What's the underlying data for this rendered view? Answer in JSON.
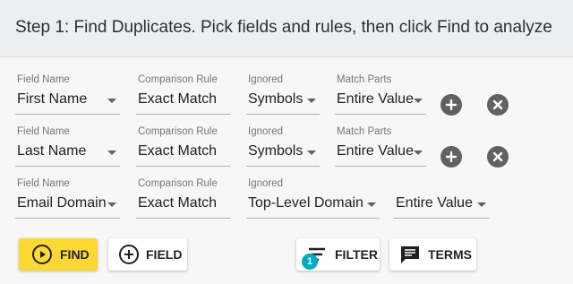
{
  "header": {
    "title": "Step 1: Find Duplicates. Pick fields and rules, then click Find to analyze"
  },
  "labels": {
    "field_name": "Field Name",
    "comparison_rule": "Comparison Rule",
    "ignored": "Ignored",
    "match_parts": "Match Parts"
  },
  "rows": [
    {
      "field": "First Name",
      "rule": "Exact Match",
      "ignored": "Symbols",
      "match_parts": "Entire Value"
    },
    {
      "field": "Last Name",
      "rule": "Exact Match",
      "ignored": "Symbols",
      "match_parts": "Entire Value"
    },
    {
      "field": "Email Domain",
      "rule": "Exact Match",
      "ignored": "Top-Level Domain",
      "match_parts": "Entire Value"
    }
  ],
  "buttons": {
    "find": "FIND",
    "field": "FIELD",
    "filter": "FILTER",
    "filter_count": "1",
    "terms": "TERMS"
  },
  "colors": {
    "accent_yellow": "#fdd835",
    "badge_teal": "#00acc1",
    "header_bg": "#eceff1"
  },
  "icons": [
    "add-circle-icon",
    "close-circle-icon",
    "play-circle-icon",
    "add-circle-outline-icon",
    "filter-list-icon",
    "comment-icon",
    "chevron-down-icon"
  ]
}
